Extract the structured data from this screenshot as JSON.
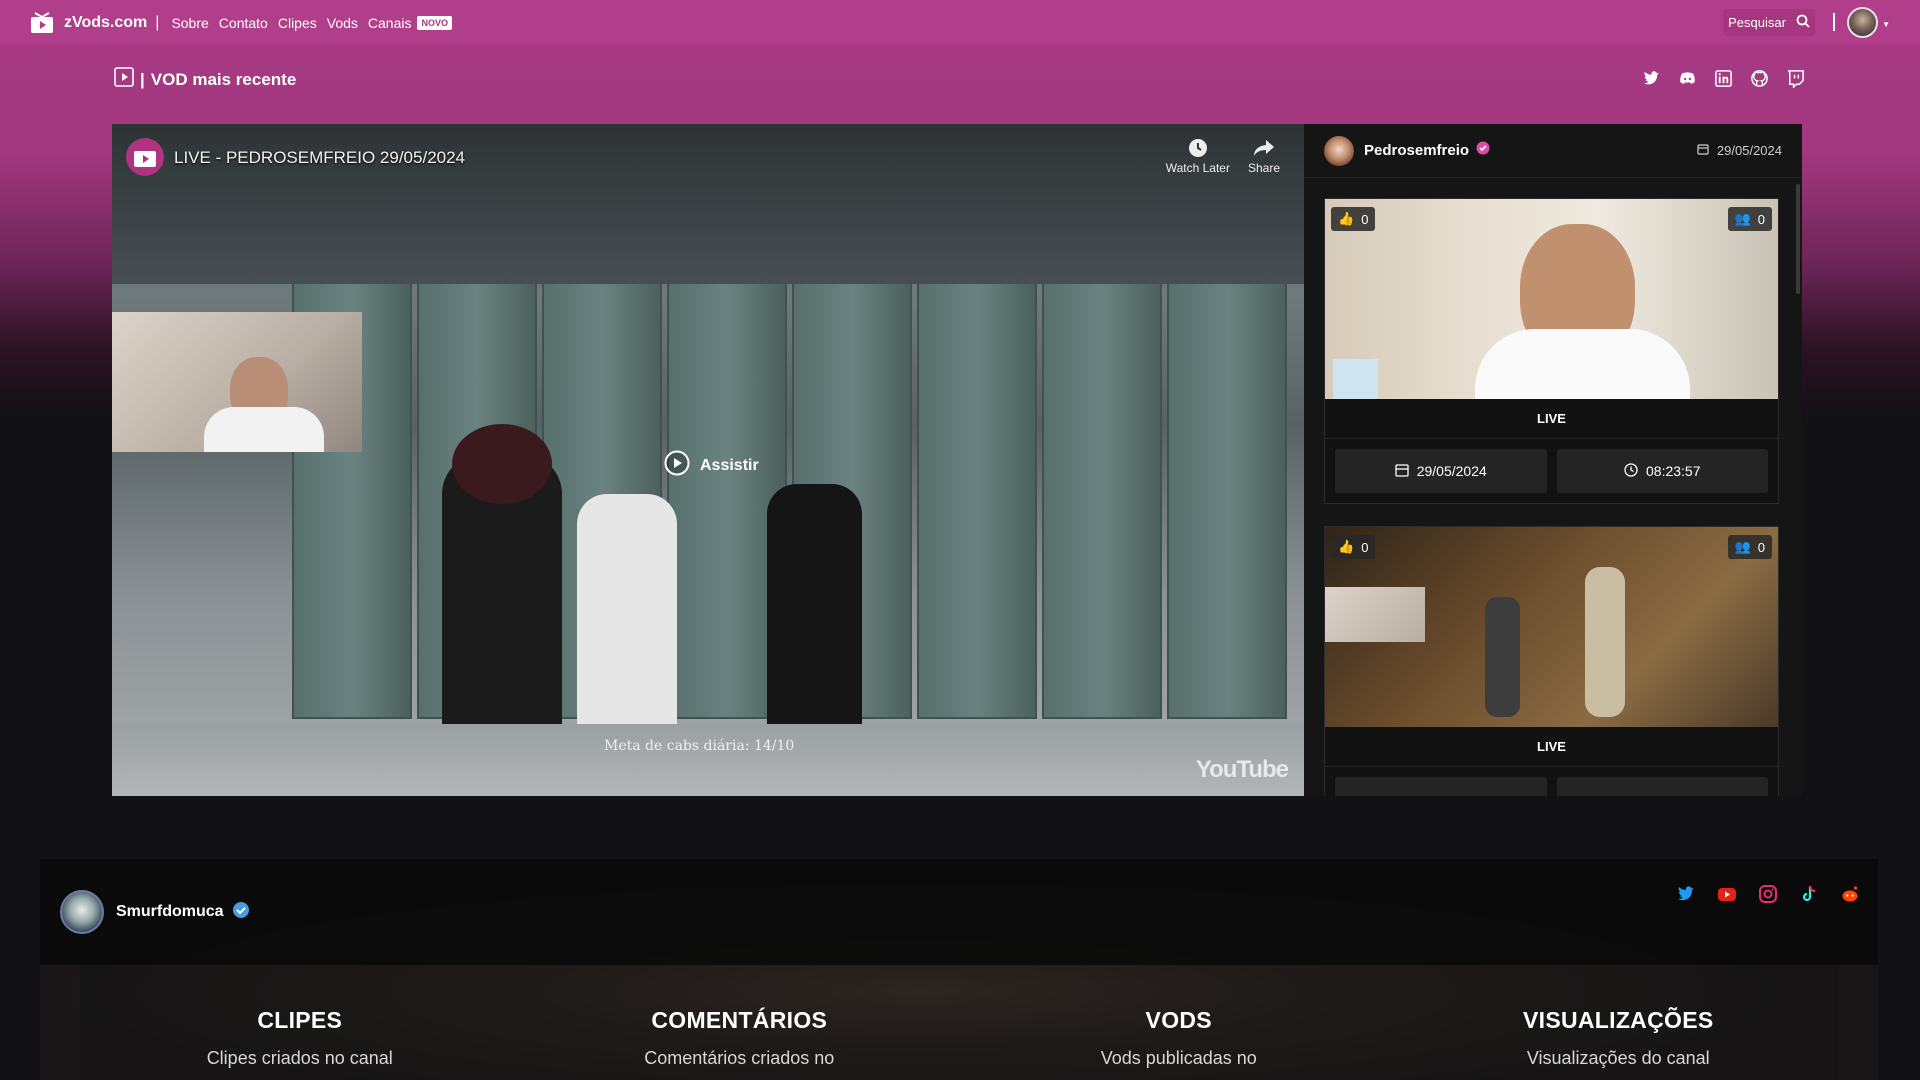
{
  "nav": {
    "brand": "zVods.com",
    "separator": "|",
    "links": [
      "Sobre",
      "Contato",
      "Clipes",
      "Vods",
      "Canais"
    ],
    "new_badge": "NOVO",
    "search_label": "Pesquisar"
  },
  "section": {
    "separator": "|",
    "title": "VOD mais recente",
    "socials": [
      "twitter-icon",
      "discord-icon",
      "linkedin-icon",
      "github-icon",
      "twitch-icon"
    ]
  },
  "player": {
    "title": "LIVE - PEDROSEMFREIO 29/05/2024",
    "watch_later": "Watch Later",
    "share": "Share",
    "play_label": "Assistir",
    "hud_text": "Meta de cabs diária: 14/10",
    "brand_watermark": "YouTube"
  },
  "sidebar": {
    "channel": "Pedrosemfreio",
    "date": "29/05/2024",
    "cards": [
      {
        "likes": "0",
        "viewers": "0",
        "label": "LIVE",
        "date": "29/05/2024",
        "duration": "08:23:57"
      },
      {
        "likes": "0",
        "viewers": "0",
        "label": "LIVE"
      }
    ]
  },
  "channel": {
    "name": "Smurfdomuca",
    "socials": [
      "twitter-icon",
      "youtube-icon",
      "instagram-icon",
      "tiktok-icon",
      "reddit-icon"
    ],
    "stats": [
      {
        "title": "CLIPES",
        "desc": "Clipes criados no canal"
      },
      {
        "title": "COMENTÁRIOS",
        "desc": "Comentários criados no"
      },
      {
        "title": "VODS",
        "desc": "Vods publicadas no"
      },
      {
        "title": "VISUALIZAÇÕES",
        "desc": "Visualizações do canal"
      }
    ]
  },
  "colors": {
    "brand": "#b13e8a",
    "badge_text": "#a8347e",
    "verified": "#d94fa8",
    "channel_verified": "#4a9be0"
  }
}
